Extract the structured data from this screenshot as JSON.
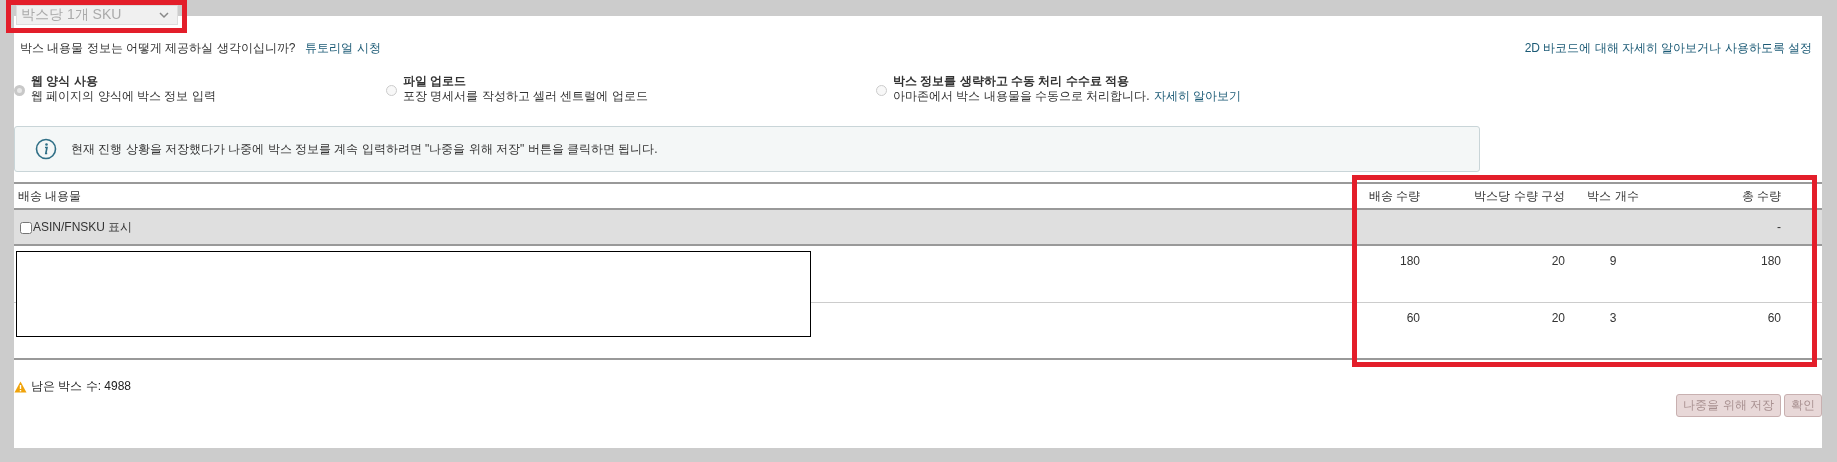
{
  "dropdown": {
    "value": "박스당 1개 SKU",
    "disabled": true
  },
  "question": {
    "text": "박스 내용물 정보는 어떻게 제공하실 생각이십니까?",
    "link": "튜토리얼 시청"
  },
  "barcode_link": "2D 바코드에 대해 자세히 알아보거나 사용하도록 설정",
  "options": [
    {
      "title": "웹 양식 사용",
      "description": "웹 페이지의 양식에 박스 정보 입력",
      "selected": true
    },
    {
      "title": "파일 업로드",
      "description": "포장 명세서를 작성하고 셀러 센트럴에 업로드",
      "selected": false
    },
    {
      "title": "박스 정보를 생략하고 수동 처리 수수료 적용",
      "description": "아마존에서 박스 내용물을 수동으로 처리합니다.",
      "link": "자세히 알아보기",
      "selected": false
    }
  ],
  "info_message": "현재 진행 상황을 저장했다가 나중에 박스 정보를 계속 입력하려면 \"나중을 위해 저장\" 버튼을 클릭하면 됩니다.",
  "table": {
    "columns": [
      "배송 내용물",
      "배송 수량",
      "박스당 수량 구성",
      "박스 개수",
      "총 수량"
    ],
    "filter_row": {
      "label": "ASIN/FNSKU 표시",
      "checked": false,
      "total": "-"
    },
    "rows": [
      {
        "shipped": "180",
        "per_box": "20",
        "boxes": "9",
        "total": "180"
      },
      {
        "shipped": "60",
        "per_box": "20",
        "boxes": "3",
        "total": "60"
      }
    ]
  },
  "remaining_boxes": "남은 박스 수: 4988",
  "buttons": [
    {
      "label": "나중을 위해 저장",
      "disabled": true
    },
    {
      "label": "확인",
      "disabled": true
    }
  ]
}
